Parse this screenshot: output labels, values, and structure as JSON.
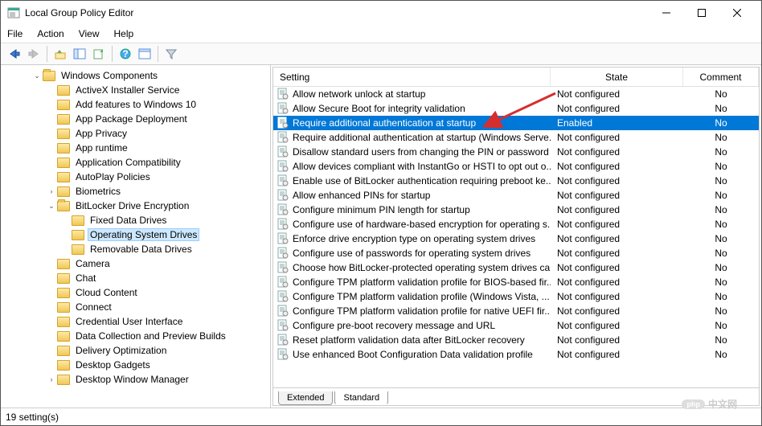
{
  "window": {
    "title": "Local Group Policy Editor"
  },
  "menu": {
    "file": "File",
    "action": "Action",
    "view": "View",
    "help": "Help"
  },
  "tree": {
    "root": "Windows Components",
    "items": [
      {
        "label": "ActiveX Installer Service",
        "indent": 3
      },
      {
        "label": "Add features to Windows 10",
        "indent": 3
      },
      {
        "label": "App Package Deployment",
        "indent": 3
      },
      {
        "label": "App Privacy",
        "indent": 3
      },
      {
        "label": "App runtime",
        "indent": 3
      },
      {
        "label": "Application Compatibility",
        "indent": 3
      },
      {
        "label": "AutoPlay Policies",
        "indent": 3
      },
      {
        "label": "Biometrics",
        "indent": 3,
        "twisty": ">"
      },
      {
        "label": "BitLocker Drive Encryption",
        "indent": 3,
        "twisty": "v",
        "open": true
      },
      {
        "label": "Fixed Data Drives",
        "indent": 4
      },
      {
        "label": "Operating System Drives",
        "indent": 4,
        "selected": true
      },
      {
        "label": "Removable Data Drives",
        "indent": 4
      },
      {
        "label": "Camera",
        "indent": 3
      },
      {
        "label": "Chat",
        "indent": 3
      },
      {
        "label": "Cloud Content",
        "indent": 3
      },
      {
        "label": "Connect",
        "indent": 3
      },
      {
        "label": "Credential User Interface",
        "indent": 3
      },
      {
        "label": "Data Collection and Preview Builds",
        "indent": 3
      },
      {
        "label": "Delivery Optimization",
        "indent": 3
      },
      {
        "label": "Desktop Gadgets",
        "indent": 3
      },
      {
        "label": "Desktop Window Manager",
        "indent": 3,
        "twisty": ">"
      }
    ]
  },
  "cols": {
    "setting": "Setting",
    "state": "State",
    "comment": "Comment"
  },
  "rows": [
    {
      "setting": "Allow network unlock at startup",
      "state": "Not configured",
      "comment": "No"
    },
    {
      "setting": "Allow Secure Boot for integrity validation",
      "state": "Not configured",
      "comment": "No"
    },
    {
      "setting": "Require additional authentication at startup",
      "state": "Enabled",
      "comment": "No",
      "selected": true
    },
    {
      "setting": "Require additional authentication at startup (Windows Serve...",
      "state": "Not configured",
      "comment": "No"
    },
    {
      "setting": "Disallow standard users from changing the PIN or password",
      "state": "Not configured",
      "comment": "No"
    },
    {
      "setting": "Allow devices compliant with InstantGo or HSTI to opt out o...",
      "state": "Not configured",
      "comment": "No"
    },
    {
      "setting": "Enable use of BitLocker authentication requiring preboot ke...",
      "state": "Not configured",
      "comment": "No"
    },
    {
      "setting": "Allow enhanced PINs for startup",
      "state": "Not configured",
      "comment": "No"
    },
    {
      "setting": "Configure minimum PIN length for startup",
      "state": "Not configured",
      "comment": "No"
    },
    {
      "setting": "Configure use of hardware-based encryption for operating s...",
      "state": "Not configured",
      "comment": "No"
    },
    {
      "setting": "Enforce drive encryption type on operating system drives",
      "state": "Not configured",
      "comment": "No"
    },
    {
      "setting": "Configure use of passwords for operating system drives",
      "state": "Not configured",
      "comment": "No"
    },
    {
      "setting": "Choose how BitLocker-protected operating system drives ca...",
      "state": "Not configured",
      "comment": "No"
    },
    {
      "setting": "Configure TPM platform validation profile for BIOS-based fir...",
      "state": "Not configured",
      "comment": "No"
    },
    {
      "setting": "Configure TPM platform validation profile (Windows Vista, ...",
      "state": "Not configured",
      "comment": "No"
    },
    {
      "setting": "Configure TPM platform validation profile for native UEFI fir...",
      "state": "Not configured",
      "comment": "No"
    },
    {
      "setting": "Configure pre-boot recovery message and URL",
      "state": "Not configured",
      "comment": "No"
    },
    {
      "setting": "Reset platform validation data after BitLocker recovery",
      "state": "Not configured",
      "comment": "No"
    },
    {
      "setting": "Use enhanced Boot Configuration Data validation profile",
      "state": "Not configured",
      "comment": "No"
    }
  ],
  "tabs": {
    "extended": "Extended",
    "standard": "Standard"
  },
  "status": "19 setting(s)",
  "watermark": {
    "badge": "php",
    "text": "中文网"
  }
}
